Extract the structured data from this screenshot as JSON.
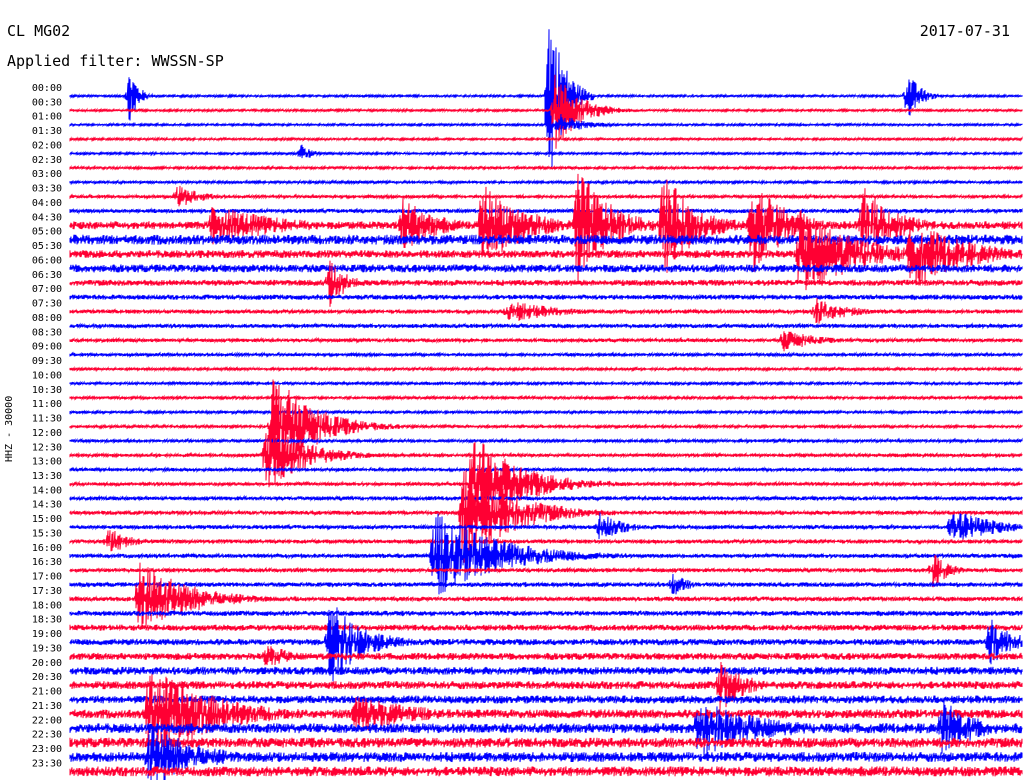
{
  "header": {
    "station": "CL MG02",
    "filter": "Applied filter: WWSSN-SP",
    "date": "2017-07-31"
  },
  "axis": {
    "ylabel": "HHZ - 30000"
  },
  "chart_data": {
    "type": "line",
    "title": "",
    "xlabel": "",
    "ylabel": "HHZ - 30000",
    "colors": [
      "#0000ff",
      "#ff0033"
    ],
    "hour_labels": [
      "00:00",
      "00:30",
      "01:00",
      "01:30",
      "02:00",
      "02:30",
      "03:00",
      "03:30",
      "04:00",
      "04:30",
      "05:00",
      "05:30",
      "06:00",
      "06:30",
      "07:00",
      "07:30",
      "08:00",
      "08:30",
      "09:00",
      "09:30",
      "10:00",
      "10:30",
      "11:00",
      "11:30",
      "12:00",
      "12:30",
      "13:00",
      "13:30",
      "14:00",
      "14:30",
      "15:00",
      "15:30",
      "16:00",
      "16:30",
      "17:00",
      "17:30",
      "18:00",
      "18:30",
      "19:00",
      "19:30",
      "20:00",
      "20:30",
      "21:00",
      "21:30",
      "22:00",
      "22:30",
      "23:00",
      "23:30"
    ],
    "x_range_minutes": [
      0,
      30
    ],
    "noise_levels": [
      1,
      1,
      1,
      1,
      1,
      1.2,
      1.3,
      1.5,
      2,
      4,
      5,
      4,
      4,
      3,
      2.5,
      2,
      2,
      1.8,
      1.5,
      1.3,
      1.3,
      1.3,
      1.3,
      1.3,
      1.5,
      1.6,
      1.6,
      1.7,
      2,
      2,
      2,
      2,
      2,
      2,
      2.2,
      2.3,
      2.5,
      3,
      3.2,
      3.5,
      4,
      4,
      4,
      4.5,
      5,
      5,
      5,
      5
    ],
    "events": [
      {
        "trace": 0,
        "minute": 1.9,
        "amplitude": 30,
        "duration": 0.5
      },
      {
        "trace": 0,
        "minute": 15.1,
        "amplitude": 95,
        "duration": 0.9
      },
      {
        "trace": 1,
        "minute": 15.3,
        "amplitude": 40,
        "duration": 1.5
      },
      {
        "trace": 0,
        "minute": 26.4,
        "amplitude": 25,
        "duration": 0.8
      },
      {
        "trace": 2,
        "minute": 15.4,
        "amplitude": 12,
        "duration": 1.5
      },
      {
        "trace": 4,
        "minute": 7.3,
        "amplitude": 10,
        "duration": 0.6
      },
      {
        "trace": 7,
        "minute": 3.4,
        "amplitude": 12,
        "duration": 1.5
      },
      {
        "trace": 9,
        "minute": 4.5,
        "amplitude": 22,
        "duration": 4
      },
      {
        "trace": 9,
        "minute": 10.5,
        "amplitude": 30,
        "duration": 2
      },
      {
        "trace": 9,
        "minute": 13,
        "amplitude": 45,
        "duration": 2.5
      },
      {
        "trace": 9,
        "minute": 16,
        "amplitude": 60,
        "duration": 2
      },
      {
        "trace": 9,
        "minute": 18.7,
        "amplitude": 55,
        "duration": 2
      },
      {
        "trace": 9,
        "minute": 21.5,
        "amplitude": 50,
        "duration": 2
      },
      {
        "trace": 9,
        "minute": 25,
        "amplitude": 40,
        "duration": 2
      },
      {
        "trace": 11,
        "minute": 23,
        "amplitude": 45,
        "duration": 3.5
      },
      {
        "trace": 11,
        "minute": 26.5,
        "amplitude": 35,
        "duration": 3.5
      },
      {
        "trace": 13,
        "minute": 8.2,
        "amplitude": 25,
        "duration": 1
      },
      {
        "trace": 15,
        "minute": 13.8,
        "amplitude": 12,
        "duration": 3
      },
      {
        "trace": 15,
        "minute": 23.5,
        "amplitude": 14,
        "duration": 2
      },
      {
        "trace": 17,
        "minute": 22.5,
        "amplitude": 12,
        "duration": 2
      },
      {
        "trace": 23,
        "minute": 6.4,
        "amplitude": 55,
        "duration": 2.5
      },
      {
        "trace": 25,
        "minute": 6.2,
        "amplitude": 35,
        "duration": 2.5
      },
      {
        "trace": 27,
        "minute": 12.7,
        "amplitude": 50,
        "duration": 3
      },
      {
        "trace": 29,
        "minute": 12.4,
        "amplitude": 55,
        "duration": 3
      },
      {
        "trace": 30,
        "minute": 16.7,
        "amplitude": 15,
        "duration": 1.5
      },
      {
        "trace": 30,
        "minute": 27.8,
        "amplitude": 20,
        "duration": 2.5
      },
      {
        "trace": 31,
        "minute": 1.2,
        "amplitude": 14,
        "duration": 1.5
      },
      {
        "trace": 32,
        "minute": 11.5,
        "amplitude": 45,
        "duration": 4
      },
      {
        "trace": 33,
        "minute": 27.2,
        "amplitude": 18,
        "duration": 1
      },
      {
        "trace": 34,
        "minute": 19,
        "amplitude": 12,
        "duration": 1
      },
      {
        "trace": 35,
        "minute": 2.2,
        "amplitude": 40,
        "duration": 3
      },
      {
        "trace": 38,
        "minute": 8.2,
        "amplitude": 45,
        "duration": 2
      },
      {
        "trace": 38,
        "minute": 29,
        "amplitude": 25,
        "duration": 1.5
      },
      {
        "trace": 39,
        "minute": 6.2,
        "amplitude": 14,
        "duration": 1.5
      },
      {
        "trace": 41,
        "minute": 20.5,
        "amplitude": 28,
        "duration": 1.5
      },
      {
        "trace": 43,
        "minute": 2.5,
        "amplitude": 50,
        "duration": 4
      },
      {
        "trace": 43,
        "minute": 9,
        "amplitude": 20,
        "duration": 4
      },
      {
        "trace": 44,
        "minute": 19.8,
        "amplitude": 30,
        "duration": 4
      },
      {
        "trace": 44,
        "minute": 27.5,
        "amplitude": 30,
        "duration": 2
      },
      {
        "trace": 46,
        "minute": 2.5,
        "amplitude": 35,
        "duration": 3
      }
    ]
  }
}
